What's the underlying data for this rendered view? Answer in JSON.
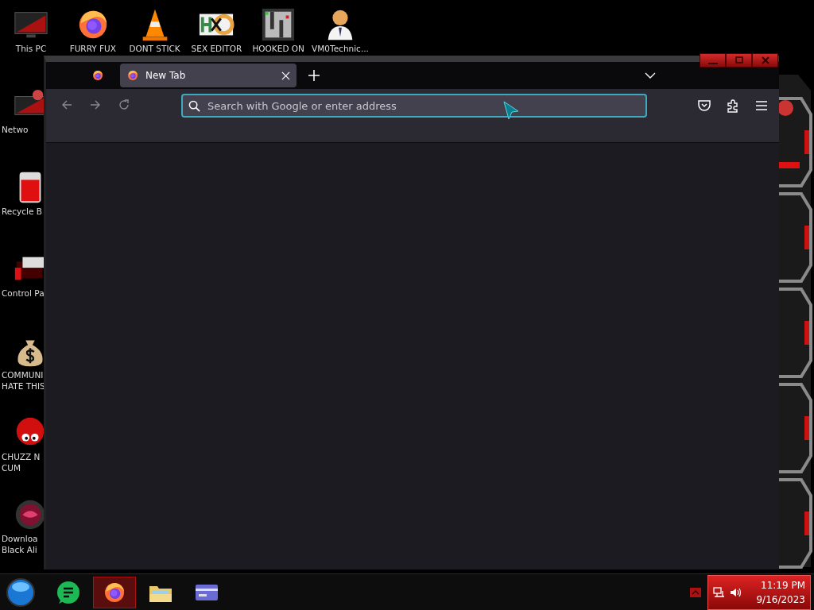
{
  "desktop_icons": [
    {
      "kind": "monitor",
      "lines": [
        "This PC"
      ]
    },
    {
      "kind": "firefox",
      "lines": [
        "FURRY FUX"
      ]
    },
    {
      "kind": "cone",
      "lines": [
        "DONT STICK"
      ]
    },
    {
      "kind": "hexeditor",
      "lines": [
        "SEX EDITOR"
      ]
    },
    {
      "kind": "maze",
      "lines": [
        "HOOKED ON"
      ]
    },
    {
      "kind": "doctor",
      "lines": [
        "VM0Technic..."
      ]
    },
    {
      "kind": "network",
      "lines": [
        "Netwo"
      ]
    },
    {
      "kind": "recycle",
      "lines": [
        "Recycle B"
      ]
    },
    {
      "kind": "control",
      "lines": [
        "Control Pa"
      ]
    },
    {
      "kind": "moneybag",
      "lines": [
        "COMMUNI",
        "HATE THIS"
      ]
    },
    {
      "kind": "creature",
      "lines": [
        "CHUZZ N",
        "CUM"
      ]
    },
    {
      "kind": "orb",
      "lines": [
        "Downloa",
        "Black Ali"
      ]
    }
  ],
  "browser": {
    "tabs": [
      {
        "kind": "pinned",
        "selected": false
      },
      {
        "kind": "normal",
        "label": "New Tab",
        "selected": true
      }
    ],
    "nav_buttons": [
      {
        "kind": "back",
        "disabled": true
      },
      {
        "kind": "forward",
        "disabled": true
      },
      {
        "kind": "reload",
        "disabled": true
      }
    ],
    "address_bar": {
      "placeholder": "Search with Google or enter address"
    },
    "toolbar_icons": [
      {
        "kind": "pocket"
      },
      {
        "kind": "extensions"
      },
      {
        "kind": "menu"
      }
    ]
  },
  "taskbar": {
    "apps": [
      {
        "kind": "chat",
        "selected": false
      },
      {
        "kind": "firefox",
        "selected": true
      },
      {
        "kind": "folder",
        "selected": false
      },
      {
        "kind": "card",
        "selected": false
      }
    ],
    "clock": {
      "time": "11:19 PM",
      "date": "9/16/2023"
    }
  }
}
